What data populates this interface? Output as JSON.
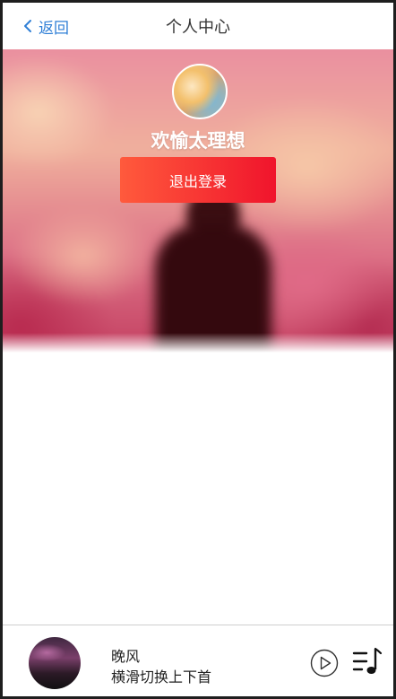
{
  "header": {
    "back_label": "返回",
    "title": "个人中心"
  },
  "profile": {
    "username": "欢愉太理想",
    "logout_label": "退出登录"
  },
  "player": {
    "song_name": "晚风",
    "hint": "横滑切换上下首"
  },
  "colors": {
    "accent_blue": "#2f7fd6",
    "logout_gradient_start": "#ff5a3c",
    "logout_gradient_end": "#f0142c"
  },
  "icons": {
    "back": "chevron-left-icon",
    "play": "play-circle-icon",
    "playlist": "playlist-music-icon"
  }
}
